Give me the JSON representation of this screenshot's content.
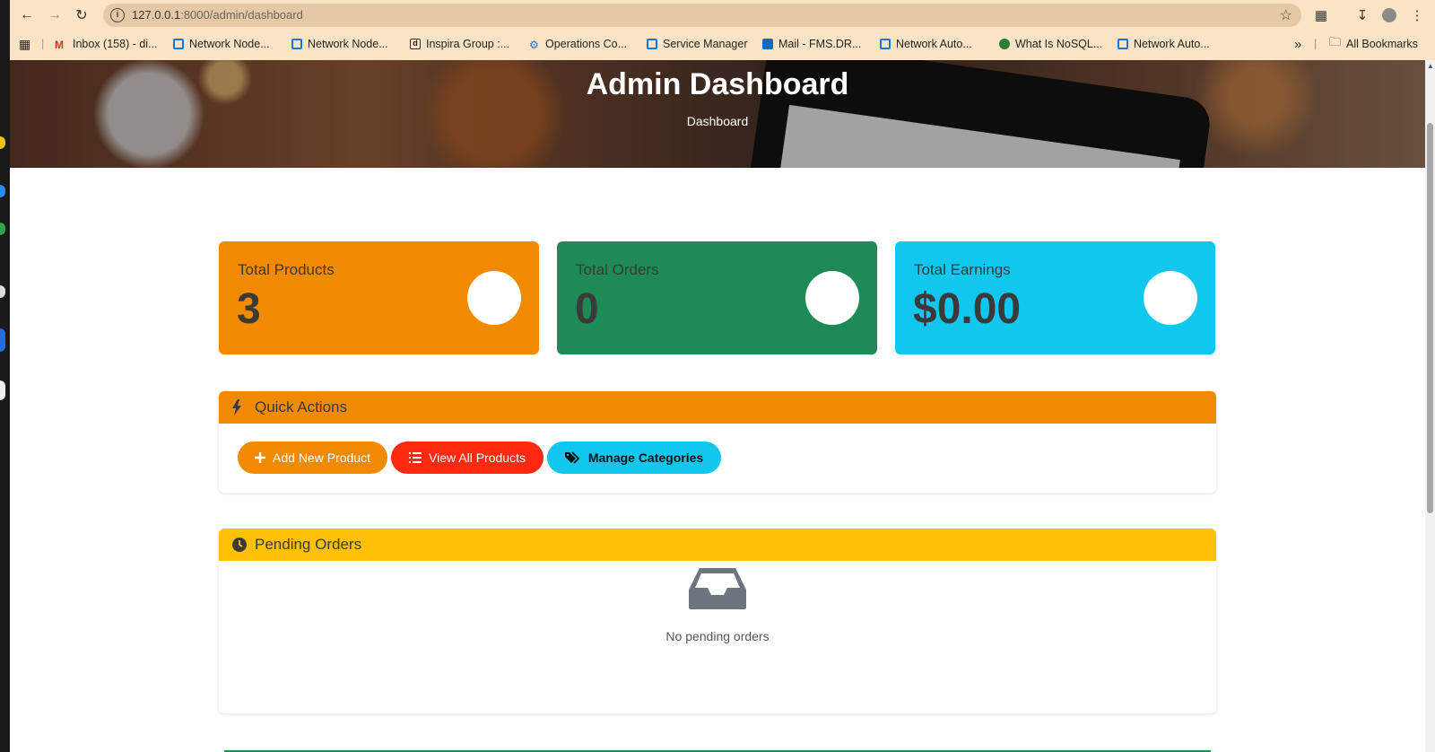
{
  "browser": {
    "url_host": "127.0.0.1",
    "url_path": ":8000/admin/dashboard",
    "bookmarks": [
      {
        "label": "Inbox (158) - di...",
        "icon": "gmail-icon"
      },
      {
        "label": "Network Node...",
        "icon": "page-icon"
      },
      {
        "label": "Network Node...",
        "icon": "page-icon"
      },
      {
        "label": "Inspira Group :...",
        "icon": "d-icon"
      },
      {
        "label": "Operations Co...",
        "icon": "ops-icon"
      },
      {
        "label": "Service Manager",
        "icon": "page-icon"
      },
      {
        "label": "Mail - FMS.DR...",
        "icon": "outlook-icon"
      },
      {
        "label": "Network Auto...",
        "icon": "page-icon"
      },
      {
        "label": "What Is NoSQL...",
        "icon": "mongo-icon"
      },
      {
        "label": "Network Auto...",
        "icon": "page-icon"
      }
    ],
    "overflow": "»",
    "all_bookmarks": "All Bookmarks"
  },
  "hero": {
    "title": "Admin Dashboard",
    "breadcrumb": "Dashboard"
  },
  "stats": [
    {
      "label": "Total Products",
      "value": "3",
      "color": "#f28a00"
    },
    {
      "label": "Total Orders",
      "value": "0",
      "color": "#1e8a55"
    },
    {
      "label": "Total Earnings",
      "value": "$0.00",
      "color": "#12c7ee"
    }
  ],
  "quick_actions": {
    "title": "Quick Actions",
    "header_color": "#f28a00",
    "buttons": [
      {
        "label": "Add New Product",
        "color": "#f28a00",
        "icon": "plus-icon"
      },
      {
        "label": "View All Products",
        "color": "#ff2a10",
        "icon": "list-icon"
      },
      {
        "label": "Manage Categories",
        "color": "#12c7ee",
        "icon": "tags-icon"
      }
    ]
  },
  "pending_orders": {
    "title": "Pending Orders",
    "header_color": "#ffc107",
    "empty_text": "No pending orders"
  }
}
